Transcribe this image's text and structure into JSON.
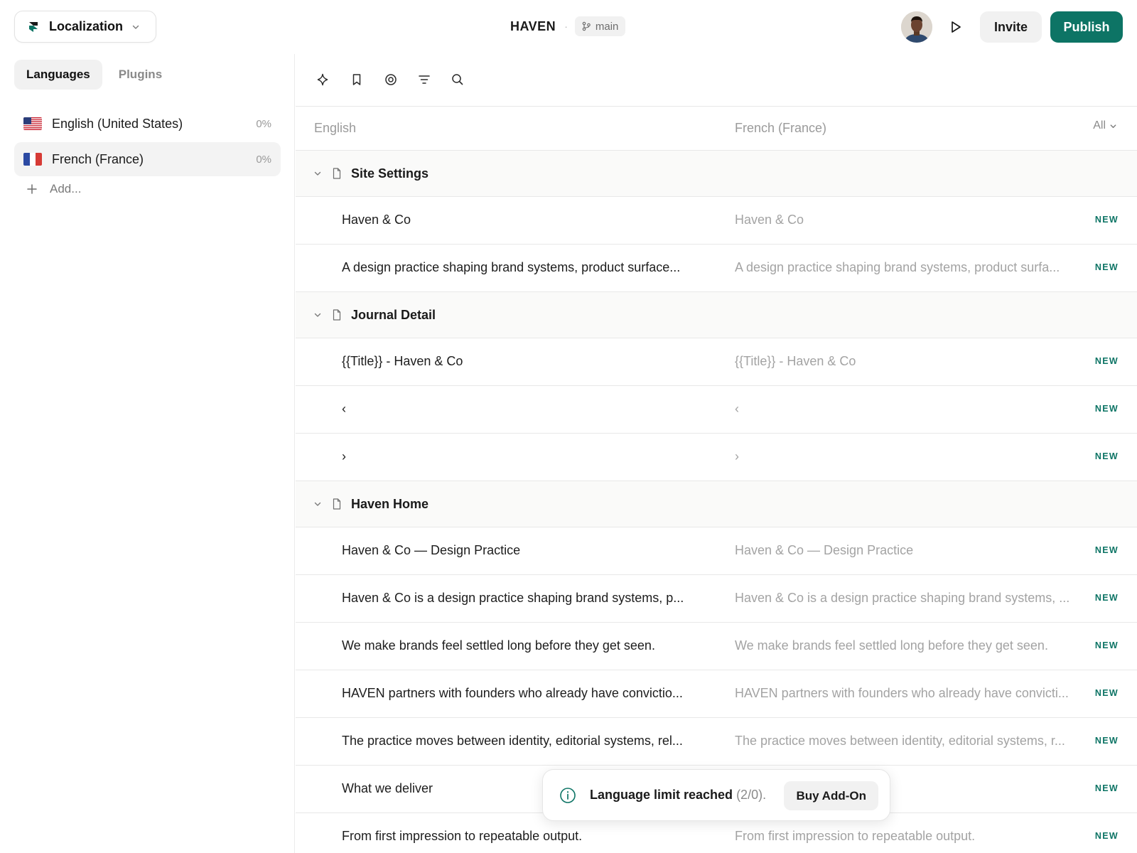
{
  "header": {
    "project_label": "Localization",
    "site_name": "HAVEN",
    "separator": "·",
    "branch": "main",
    "invite_label": "Invite",
    "publish_label": "Publish",
    "accent_color": "#0d7465"
  },
  "sidebar": {
    "tabs": [
      {
        "label": "Languages",
        "active": true
      },
      {
        "label": "Plugins",
        "active": false
      }
    ],
    "languages": [
      {
        "name": "English (United States)",
        "progress": "0%",
        "flag": "us-flag",
        "selected": false
      },
      {
        "name": "French (France)",
        "progress": "0%",
        "flag": "fr-flag",
        "selected": true
      }
    ],
    "add_label": "Add..."
  },
  "toolbar": {
    "icons": [
      "sparkle-icon",
      "bookmark-icon",
      "target-icon",
      "filter-icon",
      "search-icon"
    ]
  },
  "table": {
    "source_header": "English",
    "target_header": "French (France)",
    "filter_label": "All",
    "groups": [
      {
        "name": "Site Settings",
        "rows": [
          {
            "source": "Haven & Co",
            "target": "Haven & Co",
            "status": "NEW"
          },
          {
            "source": "A design practice shaping brand systems, product surface...",
            "target": "A design practice shaping brand systems, product surfa...",
            "status": "NEW"
          }
        ]
      },
      {
        "name": "Journal Detail",
        "rows": [
          {
            "source": "{{Title}} - Haven & Co",
            "target": "{{Title}} - Haven & Co",
            "status": "NEW"
          },
          {
            "source": "‹",
            "target": "‹",
            "status": "NEW"
          },
          {
            "source": "›",
            "target": "›",
            "status": "NEW"
          }
        ]
      },
      {
        "name": "Haven Home",
        "rows": [
          {
            "source": "Haven & Co — Design Practice",
            "target": "Haven & Co — Design Practice",
            "status": "NEW"
          },
          {
            "source": "Haven & Co is a design practice shaping brand systems, p...",
            "target": "Haven & Co is a design practice shaping brand systems, ...",
            "status": "NEW"
          },
          {
            "source": "We make brands feel settled long before they get seen.",
            "target": "We make brands feel settled long before they get seen.",
            "status": "NEW"
          },
          {
            "source": "HAVEN partners with founders who already have convictio...",
            "target": "HAVEN partners with founders who already have convicti...",
            "status": "NEW"
          },
          {
            "source": "The practice moves between identity, editorial systems, rel...",
            "target": "The practice moves between identity, editorial systems, r...",
            "status": "NEW"
          },
          {
            "source": "What we deliver",
            "target": "",
            "status": "NEW"
          },
          {
            "source": "From first impression to repeatable output.",
            "target": "From first impression to repeatable output.",
            "status": "NEW"
          }
        ]
      }
    ]
  },
  "toast": {
    "message": "Language limit reached",
    "count": "(2/0).",
    "button_label": "Buy Add-On"
  }
}
